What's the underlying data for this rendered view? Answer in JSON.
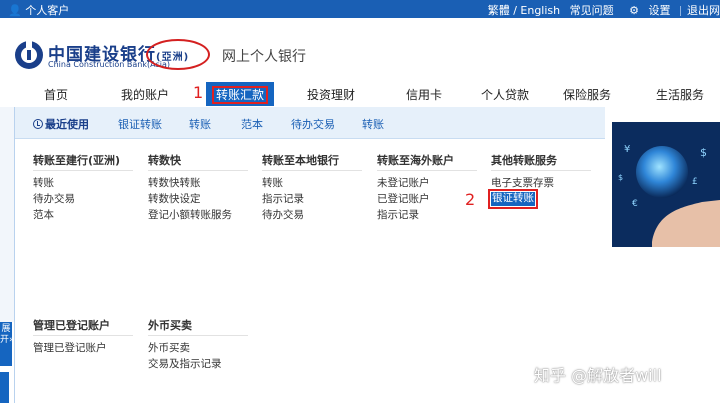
{
  "topbar": {
    "user_label": "个人客户",
    "lang": "繁體 / English",
    "faq": "常见问题",
    "settings": "设置",
    "logout": "退出网"
  },
  "brand": {
    "name_cn": "中国建设银行",
    "name_asia": "(亞洲)",
    "name_en": "China Construction Bank(Asia)",
    "subtitle": "网上个人银行"
  },
  "nav": {
    "items": [
      "首页",
      "我的账户",
      "转账汇款",
      "投资理财",
      "信用卡",
      "个人贷款",
      "保险服务",
      "生活服务"
    ],
    "active_index": 2
  },
  "markers": {
    "one": "1",
    "two": "2"
  },
  "subnav": {
    "items": [
      "最近使用",
      "银证转账",
      "转账",
      "范本",
      "待办交易",
      "转账"
    ]
  },
  "menu": {
    "columns": [
      {
        "title": "转账至建行(亚洲)",
        "links": [
          "转账",
          "待办交易",
          "范本"
        ]
      },
      {
        "title": "转数快",
        "links": [
          "转数快转账",
          "转数快设定",
          "登记小额转账服务"
        ]
      },
      {
        "title": "转账至本地银行",
        "links": [
          "转账",
          "指示记录",
          "待办交易"
        ]
      },
      {
        "title": "转账至海外账户",
        "links": [
          "未登记账户",
          "已登记账户",
          "指示记录"
        ]
      },
      {
        "title": "其他转账服务",
        "links": [
          "电子支票存票",
          "银证转账"
        ]
      },
      {
        "title": "管理已登记账户",
        "links": [
          "管理已登记账户"
        ]
      },
      {
        "title": "外币买卖",
        "links": [
          "外币买卖",
          "交易及指示记录"
        ]
      }
    ]
  },
  "side_tab": {
    "label": "展开»"
  },
  "watermark": "知乎 @解放者will",
  "colors": {
    "brand_blue": "#1565c0",
    "highlight_red": "#e02020"
  }
}
